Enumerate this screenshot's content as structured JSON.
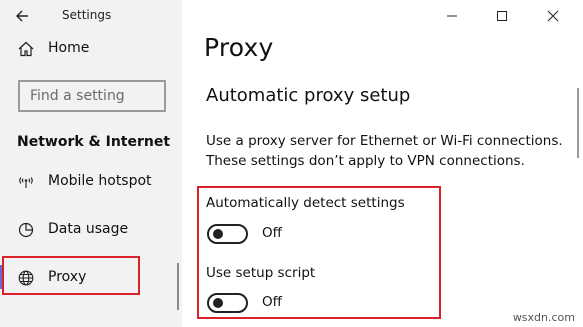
{
  "window": {
    "app_title": "Settings"
  },
  "sidebar": {
    "home_label": "Home",
    "search_placeholder": "Find a setting",
    "section_label": "Network & Internet",
    "items": [
      {
        "label": "Mobile hotspot",
        "icon": "mobile-hotspot-icon"
      },
      {
        "label": "Data usage",
        "icon": "data-usage-icon"
      },
      {
        "label": "Proxy",
        "icon": "globe-icon",
        "selected": true
      }
    ]
  },
  "main": {
    "page_title": "Proxy",
    "section_heading": "Automatic proxy setup",
    "description_line1": "Use a proxy server for Ethernet or Wi-Fi connections.",
    "description_line2": "These settings don’t apply to VPN connections.",
    "options": [
      {
        "label": "Automatically detect settings",
        "state": "Off",
        "on": false
      },
      {
        "label": "Use setup script",
        "state": "Off",
        "on": false
      }
    ]
  },
  "watermark": "wsxdn.com",
  "colors": {
    "sidebar_bg": "#f2f2f2",
    "accent": "#6b69d6",
    "annotation_red": "#d9222a"
  }
}
